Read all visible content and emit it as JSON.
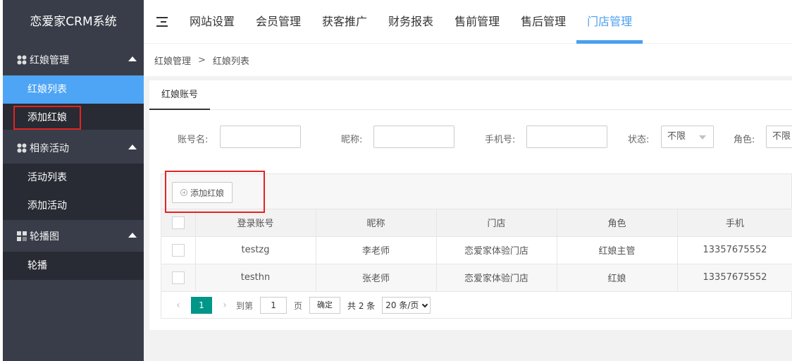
{
  "sidebar": {
    "title": "恋爱家CRM系统",
    "groups": [
      {
        "label": "红娘管理",
        "items": [
          {
            "label": "红娘列表"
          },
          {
            "label": "添加红娘"
          }
        ]
      },
      {
        "label": "相亲活动",
        "items": [
          {
            "label": "活动列表"
          },
          {
            "label": "添加活动"
          }
        ]
      },
      {
        "label": "轮播图",
        "items": [
          {
            "label": "轮播"
          }
        ]
      }
    ]
  },
  "header": {
    "tabs": [
      {
        "label": "网站设置"
      },
      {
        "label": "会员管理"
      },
      {
        "label": "获客推广"
      },
      {
        "label": "财务报表"
      },
      {
        "label": "售前管理"
      },
      {
        "label": "售后管理"
      },
      {
        "label": "门店管理"
      }
    ],
    "active_tab": "门店管理"
  },
  "breadcrumb": {
    "parent": "红娘管理",
    "separator": ">",
    "current": "红娘列表"
  },
  "tab": {
    "label": "红娘账号"
  },
  "filters": {
    "account_label": "账号名:",
    "nickname_label": "昵称:",
    "phone_label": "手机号:",
    "status_label": "状态:",
    "status_value": "不限",
    "role_label": "角色:",
    "role_value": "不限"
  },
  "toolbar": {
    "add_label": "添加红娘"
  },
  "table": {
    "columns": [
      "登录账号",
      "昵称",
      "门店",
      "角色",
      "手机"
    ],
    "rows": [
      {
        "account": "testzg",
        "nickname": "李老师",
        "store": "恋爱家体验门店",
        "role": "红娘主管",
        "phone": "13357675552"
      },
      {
        "account": "testhn",
        "nickname": "张老师",
        "store": "恋爱家体验门店",
        "role": "红娘",
        "phone": "13357675552"
      }
    ]
  },
  "pager": {
    "current_page": "1",
    "goto_label": "到第",
    "goto_value": "1",
    "page_unit": "页",
    "confirm_label": "确定",
    "total_label": "共 2 条",
    "page_size": "20 条/页"
  },
  "colors": {
    "sidebar_bg": "#393d49",
    "sidebar_sub_bg": "#282b33",
    "active_blue": "#4ea5f5",
    "pager_green": "#009688",
    "highlight_red": "#e52222"
  }
}
